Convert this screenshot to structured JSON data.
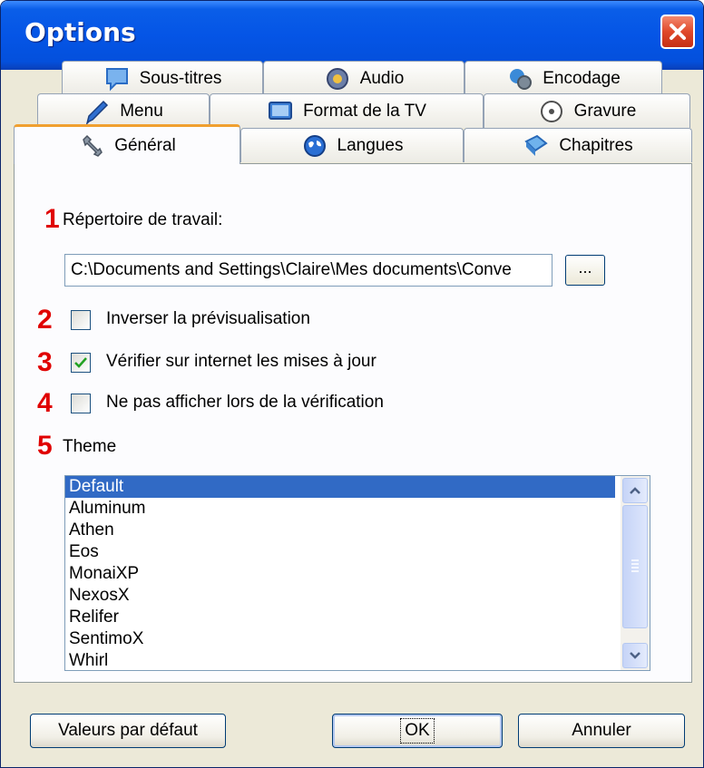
{
  "window": {
    "title": "Options"
  },
  "tabs": {
    "row1": [
      {
        "label": "Sous-titres",
        "icon": "speech-bubble-icon"
      },
      {
        "label": "Audio",
        "icon": "speaker-icon"
      },
      {
        "label": "Encodage",
        "icon": "gears-globe-icon"
      }
    ],
    "row2": [
      {
        "label": "Menu",
        "icon": "pencil-icon"
      },
      {
        "label": "Format de la TV",
        "icon": "tv-icon"
      },
      {
        "label": "Gravure",
        "icon": "disc-icon"
      }
    ],
    "row3": [
      {
        "label": "Général",
        "icon": "wrench-icon",
        "active": true
      },
      {
        "label": "Langues",
        "icon": "globe-icon"
      },
      {
        "label": "Chapitres",
        "icon": "chapter-icon"
      }
    ]
  },
  "general": {
    "markers": [
      "1",
      "2",
      "3",
      "4",
      "5"
    ],
    "workdir_label": "Répertoire de travail:",
    "workdir_value": "C:\\Documents and Settings\\Claire\\Mes documents\\Conve",
    "browse_label": "...",
    "invert_preview": {
      "label": "Inverser la prévisualisation",
      "checked": false
    },
    "check_updates": {
      "label": "Vérifier sur internet les mises à jour",
      "checked": true
    },
    "hide_on_check": {
      "label": "Ne pas afficher lors de la vérification",
      "checked": false
    },
    "theme_label": "Theme",
    "themes": [
      "Default",
      "Aluminum",
      "Athen",
      "Eos",
      "MonaiXP",
      "NexosX",
      "Relifer",
      "SentimoX",
      "Whirl"
    ],
    "selected_theme": "Default"
  },
  "buttons": {
    "defaults": "Valeurs par défaut",
    "ok": "OK",
    "cancel": "Annuler"
  },
  "colors": {
    "marker": "#e00000",
    "selection": "#316ac5",
    "titlebar": "#0555e6",
    "active_tab_accent": "#f0a030"
  }
}
